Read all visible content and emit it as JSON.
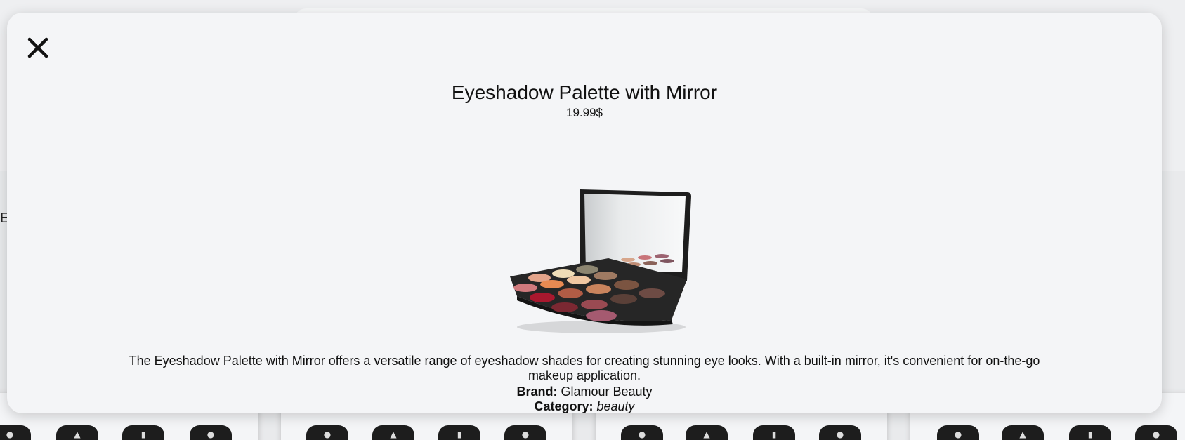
{
  "background": {
    "left_text": "E",
    "card_button_icons": [
      "cart-icon",
      "heart-icon",
      "bookmark-icon",
      "info-icon"
    ]
  },
  "modal": {
    "close_icon": "close-icon",
    "product": {
      "title": "Eyeshadow Palette with Mirror",
      "price": "19.99$",
      "image_alt": "Eyeshadow palette with mirror",
      "description": "The Eyeshadow Palette with Mirror offers a versatile range of eyeshadow shades for creating stunning eye looks. With a built-in mirror, it's convenient for on-the-go makeup application.",
      "brand_label": "Brand:",
      "brand_value": "Glamour Beauty",
      "category_label": "Category:",
      "category_value": "beauty"
    }
  },
  "colors": {
    "modal_bg": "#f4f5f7",
    "text": "#111111",
    "button_dark": "#1d1d1d"
  }
}
